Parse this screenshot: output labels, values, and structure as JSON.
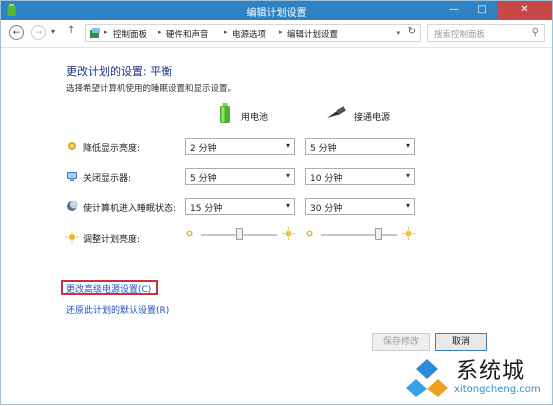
{
  "window": {
    "title": "编辑计划设置",
    "controls": {
      "minimize": "—",
      "maximize": "□",
      "close": "✕"
    }
  },
  "nav": {
    "back": "←",
    "forward": "→",
    "recent": "▾",
    "up": "↑",
    "breadcrumbs": [
      "控制面板",
      "硬件和声音",
      "电源选项",
      "编辑计划设置"
    ],
    "separator": "▸",
    "refresh": "↻",
    "dropdown": "▾",
    "search_placeholder": "搜索控制面板",
    "search_icon": "⚲"
  },
  "main": {
    "heading": "更改计划的设置: 平衡",
    "subtext": "选择希望计算机使用的睡眠设置和显示设置。",
    "columns": {
      "battery": "用电池",
      "plugged": "接通电源"
    },
    "rows": [
      {
        "label": "降低显示亮度:",
        "icon": "dim-brightness-icon",
        "battery": "2 分钟",
        "plugged": "5 分钟"
      },
      {
        "label": "关闭显示器:",
        "icon": "monitor-icon",
        "battery": "5 分钟",
        "plugged": "10 分钟"
      },
      {
        "label": "使计算机进入睡眠状态:",
        "icon": "sleep-icon",
        "battery": "15 分钟",
        "plugged": "30 分钟"
      }
    ],
    "brightness": {
      "label": "调整计划亮度:",
      "battery_level": 0.5,
      "plugged_level": 0.75
    },
    "links": {
      "advanced": "更改高级电源设置(C)",
      "restore": "还原此计划的默认设置(R)"
    },
    "buttons": {
      "save": "保存修改",
      "cancel": "取消"
    }
  },
  "watermark": {
    "text": "系统城",
    "domain": "xitongcheng.com"
  },
  "colors": {
    "titlebar": "#2f83c4",
    "heading": "#1e3287",
    "link": "#1e50c8",
    "highlight_box": "#c8333f"
  }
}
